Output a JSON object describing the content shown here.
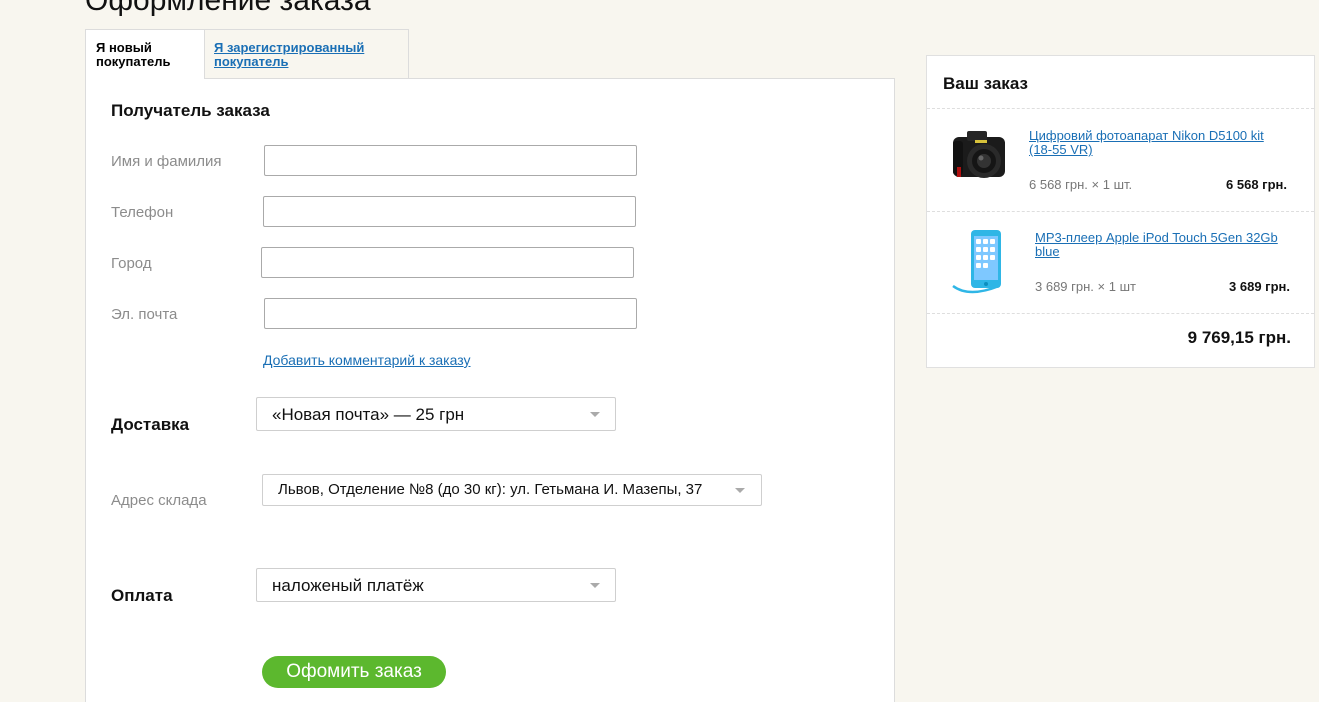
{
  "page": {
    "title": "Оформление заказа"
  },
  "tabs": [
    {
      "label": "Я новый покупатель",
      "active": true
    },
    {
      "label": "Я зарегистрированный покупатель",
      "active": false
    }
  ],
  "recipient": {
    "title": "Получатель заказа",
    "fields": [
      {
        "label": "Имя и фамилия",
        "value": ""
      },
      {
        "label": "Телефон",
        "value": ""
      },
      {
        "label": "Город",
        "value": ""
      },
      {
        "label": "Эл. почта",
        "value": ""
      }
    ],
    "comment_link": "Добавить комментарий к заказу"
  },
  "delivery": {
    "title": "Доставка",
    "method": "«Новая почта» — 25 грн",
    "warehouse_label": "Адрес склада",
    "warehouse": "Львов, Отделение №8 (до 30 кг): ул. Гетьмана И. Мазепы, 37"
  },
  "payment": {
    "title": "Оплата",
    "method": "наложеный платёж"
  },
  "submit_label": "Офомить заказ",
  "order": {
    "title": "Ваш заказ",
    "items": [
      {
        "name": "Цифровий фотоапарат Nikon D5100 kit (18-55 VR)",
        "price_qty": "6 568 грн. × 1 шт.",
        "total": "6 568 грн.",
        "icon": "camera-icon"
      },
      {
        "name": "MP3-плеер Apple iPod Touch 5Gen 32Gb blue",
        "price_qty": "3 689 грн. × 1 шт",
        "total": "3 689 грн.",
        "icon": "ipod-icon"
      }
    ],
    "grand_total": "9 769,15 грн."
  },
  "colors": {
    "background": "#f8f6ef",
    "link": "#1a6fb5",
    "submit_button": "#5cb82e",
    "ipod": "#2fb6e6"
  }
}
